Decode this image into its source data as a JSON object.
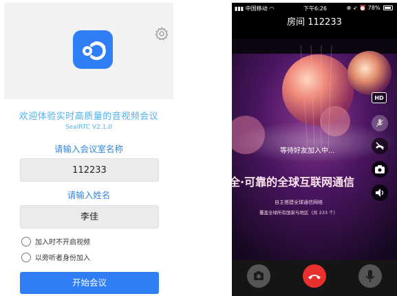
{
  "login": {
    "welcome": "欢迎体验实时高质量的音视频会议",
    "version": "SealRTC V2.1.0",
    "room_label": "请输入会议室名称",
    "room_value": "112233",
    "name_label": "请输入姓名",
    "name_value": "李佳",
    "options": [
      "加入时不开启视频",
      "以旁听者身份加入"
    ],
    "start_button": "开始会议",
    "logo_icon": "sealrtc-logo-icon",
    "settings_icon": "gear-icon",
    "accent": "#2f7ef6",
    "text_accent": "#4fb0ee"
  },
  "call": {
    "status_carrier": "中国移动",
    "status_time": "下午6:26",
    "status_battery": "78%",
    "room_title": "房间 112233",
    "waiting_text": "等待好友加入中...",
    "video_banner": "全·可靠的全球互联网通信",
    "video_subline_1": "自主搭建全球通信网络",
    "video_subline_2": "覆盖全球所有国家与地区（共 233 个）",
    "hd_label": "HD",
    "side_icons": [
      "hd-icon",
      "mic-mute-icon",
      "hangup-small-icon",
      "camera-switch-icon",
      "speaker-icon"
    ],
    "bottom_icons": [
      "camera-icon",
      "hangup-icon",
      "microphone-icon"
    ],
    "hangup_color": "#e8312f"
  }
}
